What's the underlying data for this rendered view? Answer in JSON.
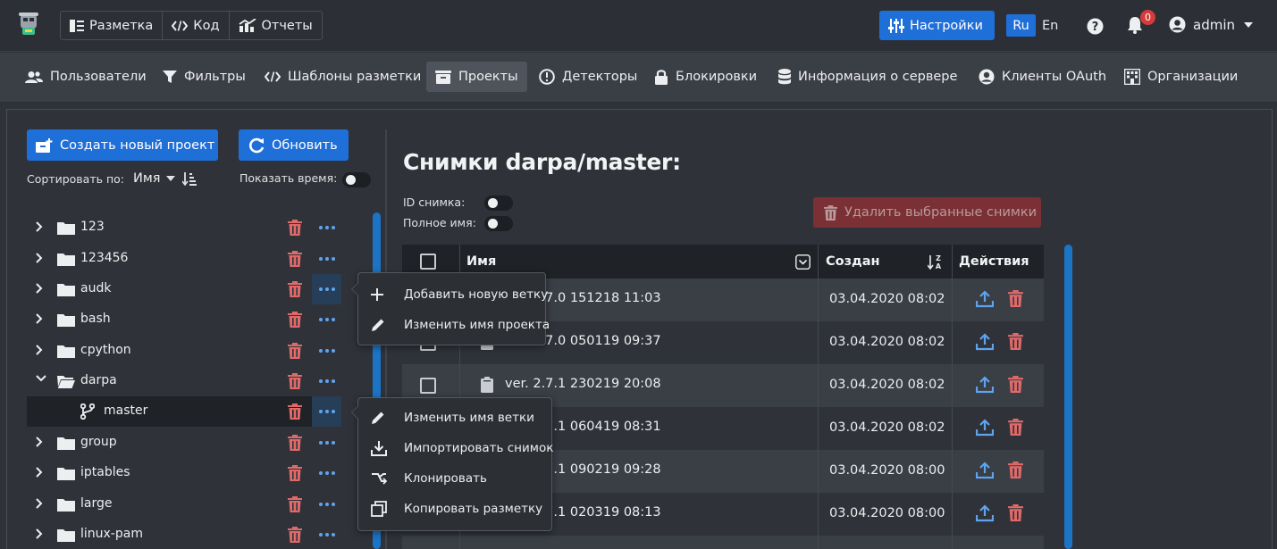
{
  "topbar": {
    "modes": [
      {
        "label": "Разметка",
        "icon": "list-icon"
      },
      {
        "label": "Код",
        "icon": "code-icon"
      },
      {
        "label": "Отчеты",
        "icon": "chart-icon"
      }
    ],
    "settings_label": "Настройки",
    "lang_ru": "Ru",
    "lang_en": "En",
    "notifications_count": "0",
    "user_name": "admin"
  },
  "nav": {
    "items": [
      {
        "label": "Пользователи",
        "icon": "users-icon"
      },
      {
        "label": "Фильтры",
        "icon": "filter-icon"
      },
      {
        "label": "Шаблоны разметки",
        "icon": "code-icon"
      },
      {
        "label": "Проекты",
        "icon": "inbox-icon",
        "active": true
      },
      {
        "label": "Детекторы",
        "icon": "exclamation-circle-icon"
      },
      {
        "label": "Блокировки",
        "icon": "lock-icon"
      },
      {
        "label": "Информация о сервере",
        "icon": "database-icon"
      },
      {
        "label": "Клиенты OAuth",
        "icon": "user-circle-icon"
      },
      {
        "label": "Организации",
        "icon": "building-icon"
      }
    ]
  },
  "projects": {
    "create_label": "Создать новый проект",
    "refresh_label": "Обновить",
    "sort_label": "Сортировать по:",
    "sort_value": "Имя",
    "show_time_label": "Показать время:",
    "tree": [
      {
        "name": "123",
        "expanded": false
      },
      {
        "name": "123456",
        "expanded": false
      },
      {
        "name": "audk",
        "expanded": false
      },
      {
        "name": "bash",
        "expanded": false
      },
      {
        "name": "cpython",
        "expanded": false
      },
      {
        "name": "darpa",
        "expanded": true
      },
      {
        "name": "group",
        "expanded": false
      },
      {
        "name": "iptables",
        "expanded": false
      },
      {
        "name": "large",
        "expanded": false
      },
      {
        "name": "linux-pam",
        "expanded": false
      }
    ],
    "branch": "master"
  },
  "project_menu": {
    "items": [
      "Добавить новую ветку",
      "Изменить имя проекта"
    ]
  },
  "branch_menu": {
    "items": [
      "Изменить имя ветки",
      "Импортировать снимок",
      "Клонировать",
      "Копировать разметку"
    ]
  },
  "snapshots": {
    "title": "Снимки darpa/master:",
    "id_label": "ID снимка:",
    "fullname_label": "Полное имя:",
    "delete_selected_label": "Удалить выбранные снимки",
    "columns": {
      "name": "Имя",
      "created": "Создан",
      "actions": "Действия"
    },
    "rows": [
      {
        "name": "ver. 2.7.0 151218 11:03",
        "created": "03.04.2020 08:02"
      },
      {
        "name": "ver. 2.7.0 050119 09:37",
        "created": "03.04.2020 08:02"
      },
      {
        "name": "ver. 2.7.1 230219 20:08",
        "created": "03.04.2020 08:02"
      },
      {
        "name": "ver. 2.7.1 060419 08:31",
        "created": "03.04.2020 08:02"
      },
      {
        "name": "ver. 2.7.1 090219 09:28",
        "created": "03.04.2020 08:00"
      },
      {
        "name": "ver. 2.7.1 020319 08:13",
        "created": "03.04.2020 08:00"
      }
    ]
  },
  "colors": {
    "accent": "#1f6fd8",
    "danger": "#e06a6a",
    "icon_blue": "#5fa4f0"
  }
}
